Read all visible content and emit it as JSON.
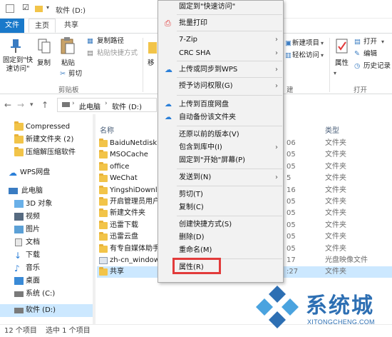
{
  "window": {
    "title": "软件 (D:)"
  },
  "tabs": [
    "文件",
    "主页",
    "共享"
  ],
  "ribbon": {
    "pin_label": "固定到\"快速访问\"",
    "copy_label": "复制",
    "paste_label": "粘贴",
    "copy_path_label": "复制路径",
    "paste_shortcut_label": "粘贴快捷方式",
    "cut_label": "剪切",
    "move_label": "移",
    "group_clipboard": "剪贴板",
    "new_item_label": "新建项目",
    "easy_access_label": "轻松访问",
    "new_group_label": "建",
    "properties_label": "属性",
    "open_label": "打开",
    "edit_label": "编辑",
    "history_label": "历史记录",
    "group_open": "打开"
  },
  "address": {
    "this_pc": "此电脑",
    "drive": "软件 (D:)"
  },
  "nav": {
    "quick": [
      {
        "label": "Compressed",
        "icon": "folder-icon"
      },
      {
        "label": "新建文件夹 (2)",
        "icon": "folder-icon"
      },
      {
        "label": "压缩解压缩软件",
        "icon": "folder-icon"
      }
    ],
    "wps": "WPS网盘",
    "this_pc": "此电脑",
    "pc_items": [
      {
        "label": "3D 对象",
        "icon": "cube-icon"
      },
      {
        "label": "视频",
        "icon": "video-icon"
      },
      {
        "label": "图片",
        "icon": "picture-icon"
      },
      {
        "label": "文档",
        "icon": "document-icon"
      },
      {
        "label": "下载",
        "icon": "download-icon"
      },
      {
        "label": "音乐",
        "icon": "music-icon"
      },
      {
        "label": "桌面",
        "icon": "desktop-icon"
      },
      {
        "label": "系统 (C:)",
        "icon": "drive-icon"
      },
      {
        "label": "软件 (D:)",
        "icon": "drive-icon"
      }
    ]
  },
  "filelist": {
    "col_name": "名称",
    "col_type": "类型",
    "rows": [
      {
        "name": "BaiduNetdiskDo",
        "date": "06",
        "type": "文件夹"
      },
      {
        "name": "MSOCache",
        "date": "05",
        "type": "文件夹"
      },
      {
        "name": "office",
        "date": "05",
        "type": "文件夹"
      },
      {
        "name": "WeChat",
        "date": "5",
        "type": "文件夹"
      },
      {
        "name": "YingshiDownlo",
        "date": "16",
        "type": "文件夹"
      },
      {
        "name": "开启管理员用户",
        "date": "05",
        "type": "文件夹"
      },
      {
        "name": "新建文件夹",
        "date": "05",
        "type": "文件夹"
      },
      {
        "name": "迅雷下载",
        "date": "05",
        "type": "文件夹"
      },
      {
        "name": "迅雷云盘",
        "date": "05",
        "type": "文件夹"
      },
      {
        "name": "有专自媒体助手",
        "date": "05",
        "type": "文件夹"
      },
      {
        "name": "zh-cn_windows_",
        "date": "17",
        "type": "光盘映像文件"
      },
      {
        "name": "共享",
        "date": ":27",
        "type": "文件夹"
      }
    ]
  },
  "status": {
    "count": "12 个项目",
    "selected": "选中 1 个项目"
  },
  "menu": {
    "items": [
      {
        "label": "固定到\"快速访问\"",
        "arrow": ""
      },
      {
        "label": "批量打印",
        "arrow": ""
      },
      {
        "label": "7-Zip",
        "arrow": "›"
      },
      {
        "label": "CRC SHA",
        "arrow": "›"
      },
      {
        "label": "上传或同步到WPS",
        "arrow": "›"
      },
      {
        "label": "授予访问权限(G)",
        "arrow": "›"
      },
      {
        "label": "上传到百度网盘",
        "arrow": ""
      },
      {
        "label": "自动备份该文件夹",
        "arrow": ""
      },
      {
        "label": "还原以前的版本(V)",
        "arrow": ""
      },
      {
        "label": "包含到库中(I)",
        "arrow": "›"
      },
      {
        "label": "固定到\"开始\"屏幕(P)",
        "arrow": ""
      },
      {
        "label": "发送到(N)",
        "arrow": "›"
      },
      {
        "label": "剪切(T)",
        "arrow": ""
      },
      {
        "label": "复制(C)",
        "arrow": ""
      },
      {
        "label": "创建快捷方式(S)",
        "arrow": ""
      },
      {
        "label": "删除(D)",
        "arrow": ""
      },
      {
        "label": "重命名(M)",
        "arrow": ""
      },
      {
        "label": "属性(R)",
        "arrow": ""
      }
    ]
  },
  "watermark": {
    "text": "系统城",
    "sub": "XITONGCHENG.COM"
  },
  "colors": {
    "accent": "#1979ca",
    "highlight_box": "#e23b3b",
    "selection": "#cce8ff",
    "folder": "#f2c449"
  }
}
